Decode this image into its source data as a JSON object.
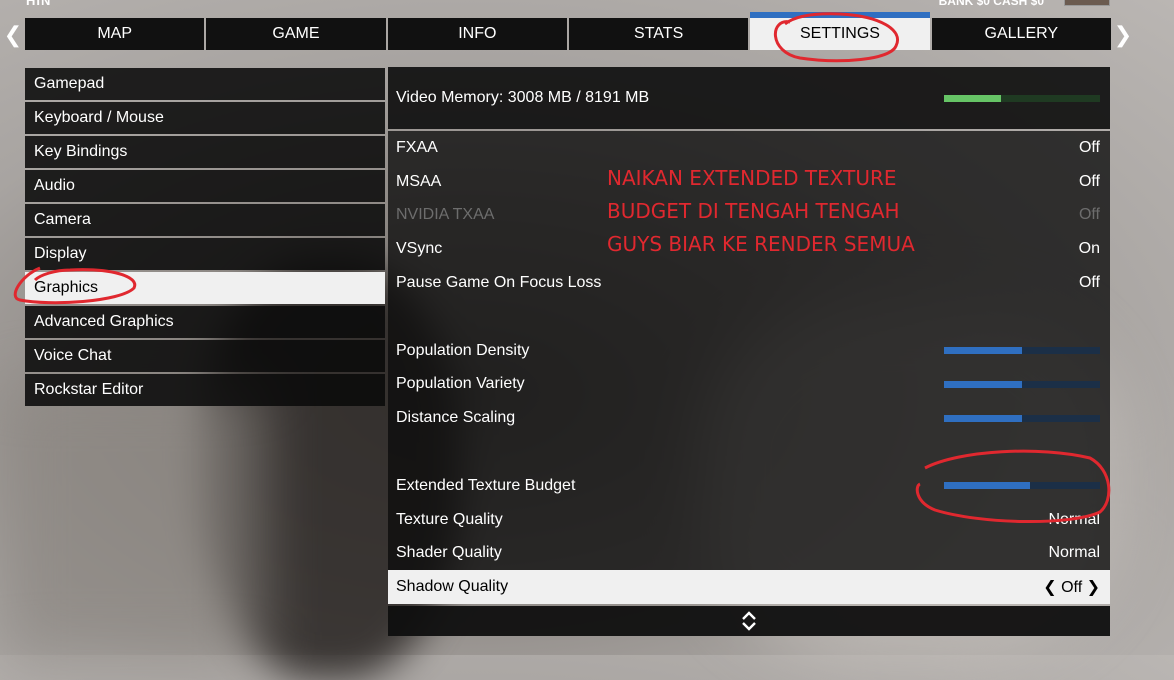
{
  "header": {
    "left_text": "HIN",
    "right_text": "BANK $0  CASH $0"
  },
  "tabs": [
    {
      "label": "MAP"
    },
    {
      "label": "GAME"
    },
    {
      "label": "INFO"
    },
    {
      "label": "STATS"
    },
    {
      "label": "SETTINGS",
      "active": true
    },
    {
      "label": "GALLERY"
    }
  ],
  "menu": [
    {
      "label": "Gamepad"
    },
    {
      "label": "Keyboard / Mouse"
    },
    {
      "label": "Key Bindings"
    },
    {
      "label": "Audio"
    },
    {
      "label": "Camera"
    },
    {
      "label": "Display"
    },
    {
      "label": "Graphics",
      "active": true
    },
    {
      "label": "Advanced Graphics"
    },
    {
      "label": "Voice Chat"
    },
    {
      "label": "Rockstar Editor"
    }
  ],
  "video_memory": {
    "label": "Video Memory: 3008 MB / 8191 MB",
    "used": 3008,
    "total": 8191,
    "bar_color": "#66c466"
  },
  "options": {
    "fxaa": {
      "label": "FXAA",
      "value": "Off"
    },
    "msaa": {
      "label": "MSAA",
      "value": "Off"
    },
    "txaa": {
      "label": "NVIDIA TXAA",
      "value": "Off"
    },
    "vsync": {
      "label": "VSync",
      "value": "On"
    },
    "pause": {
      "label": "Pause Game On Focus Loss",
      "value": "Off"
    },
    "population_density": {
      "label": "Population Density",
      "level": 0.5
    },
    "population_variety": {
      "label": "Population Variety",
      "level": 0.5
    },
    "distance_scaling": {
      "label": "Distance Scaling",
      "level": 0.5
    },
    "extended_texture": {
      "label": "Extended Texture Budget",
      "level": 0.55
    },
    "texture_quality": {
      "label": "Texture Quality",
      "value": "Normal"
    },
    "shader_quality": {
      "label": "Shader Quality",
      "value": "Normal"
    },
    "shadow_quality": {
      "label": "Shadow Quality",
      "value": "Off"
    }
  },
  "annotation": {
    "lines": [
      "NAIKAN EXTENDED TEXTURE",
      "BUDGET DI TENGAH TENGAH",
      "GUYS BIAR KE RENDER SEMUA"
    ],
    "color": "#e0282f"
  },
  "colors": {
    "accent": "#2f6fc1",
    "slider_track": "#1b2f47"
  }
}
